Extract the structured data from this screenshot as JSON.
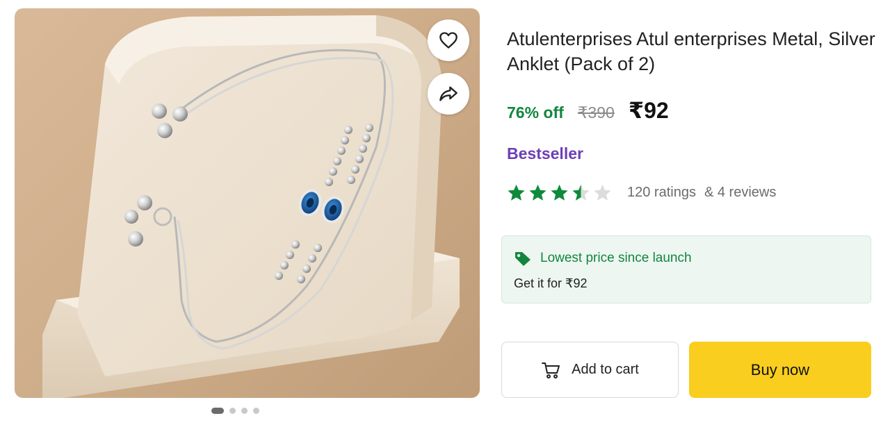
{
  "product": {
    "title": "Atulenterprises Atul enterprises Metal, Silver Anklet (Pack of 2)",
    "discount": "76% off",
    "mrp": "₹390",
    "price": "₹92",
    "badge": "Bestseller",
    "rating": {
      "value": 3.5,
      "max": 5
    },
    "ratings_count": "120 ratings",
    "reviews_count": "& 4 reviews"
  },
  "gallery": {
    "image_count": 4,
    "active_index": 0,
    "icons": {
      "wishlist": "heart-icon",
      "share": "share-icon"
    }
  },
  "offer": {
    "title": "Lowest price since launch",
    "subtitle": "Get it for ₹92",
    "icon": "price-tag-icon"
  },
  "actions": {
    "add_to_cart": "Add to cart",
    "buy_now": "Buy now",
    "cart_icon": "cart-icon"
  },
  "colors": {
    "discount_green": "#12863f",
    "badge_purple": "#6c3fb5",
    "star_green": "#0f8a3c",
    "buy_yellow": "#f9ce1e"
  }
}
